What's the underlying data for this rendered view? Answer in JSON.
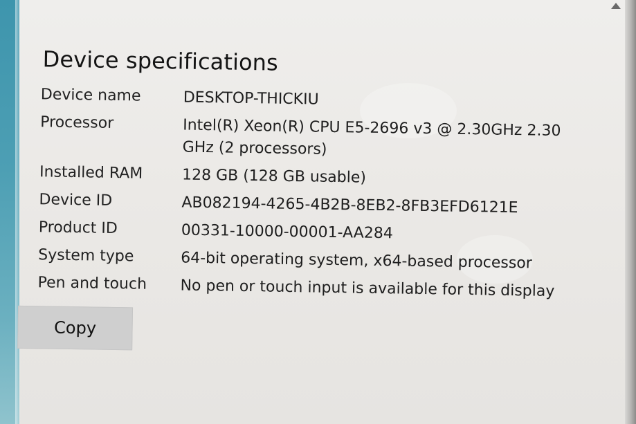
{
  "section": {
    "heading": "Device specifications"
  },
  "specs": [
    {
      "label": "Device name",
      "value": "DESKTOP-THICKIU"
    },
    {
      "label": "Processor",
      "value": "Intel(R) Xeon(R) CPU E5-2696 v3 @ 2.30GHz   2.30 GHz  (2 processors)"
    },
    {
      "label": "Installed RAM",
      "value": "128 GB (128 GB usable)"
    },
    {
      "label": "Device ID",
      "value": "AB082194-4265-4B2B-8EB2-8FB3EFD6121E"
    },
    {
      "label": "Product ID",
      "value": "00331-10000-00001-AA284"
    },
    {
      "label": "System type",
      "value": "64-bit operating system, x64-based processor"
    },
    {
      "label": "Pen and touch",
      "value": "No pen or touch input is available for this display"
    }
  ],
  "actions": {
    "copy_label": "Copy"
  },
  "colors": {
    "accent_edge": "#4d9fb4",
    "background": "#ebe9e6",
    "button_background": "#cfcfcf",
    "text": "#1b1b1b"
  }
}
